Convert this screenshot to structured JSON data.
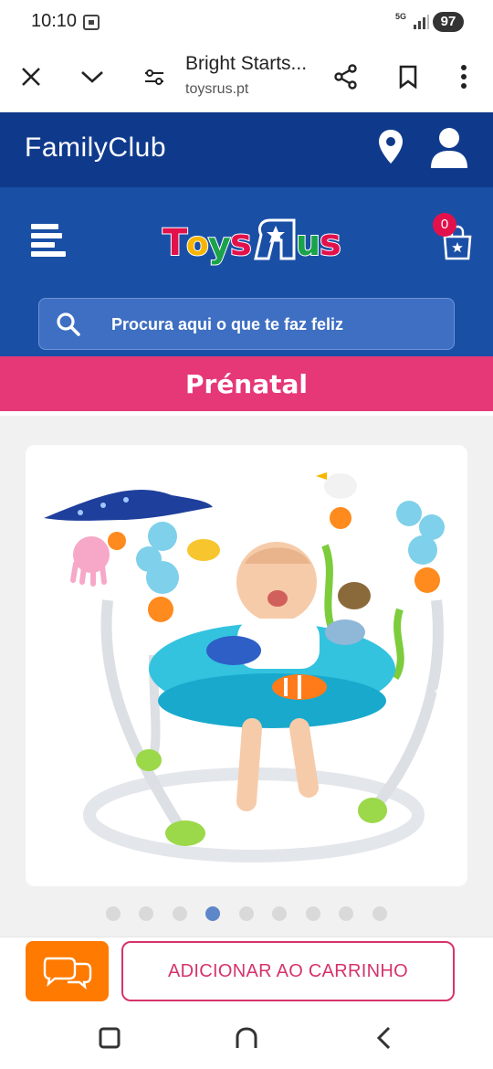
{
  "status_bar": {
    "time": "10:10",
    "network": "5G",
    "battery": "97"
  },
  "browser": {
    "page_title": "Bright Starts...",
    "url": "toysrus.pt",
    "icons": [
      "close-icon",
      "chevron-down-icon",
      "page-settings-icon",
      "share-icon",
      "bookmark-icon",
      "more-vert-icon"
    ]
  },
  "family_club": {
    "label": "FamilyClub",
    "icons": [
      "location-pin-icon",
      "user-icon"
    ]
  },
  "header": {
    "logo_text": "ToysRUs",
    "logo_colors": [
      "#e3114b",
      "#f7b500",
      "#1aa34a",
      "#1a4fa6"
    ],
    "cart_count": "0",
    "search_placeholder": "Procura aqui o que te faz feliz"
  },
  "prenatal": {
    "label": "Prénatal"
  },
  "gallery": {
    "image_alt": "Bright Starts jumper Finding Nemo",
    "dot_count": 9,
    "active_dot": 4
  },
  "actions": {
    "add_to_cart_label": "ADICIONAR AO CARRINHO"
  },
  "colors": {
    "family_bg": "#0f3a8c",
    "header_bg": "#1a4fa6",
    "prenatal_bg": "#e63777",
    "chat_button": "#ff7a00",
    "cart_border": "#d6336c"
  }
}
